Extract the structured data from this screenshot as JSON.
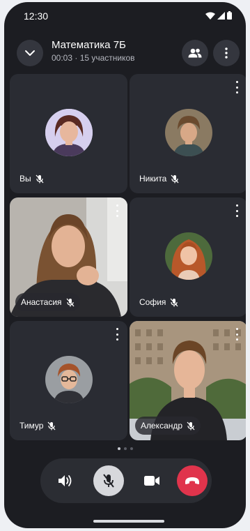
{
  "status_bar": {
    "time": "12:30"
  },
  "header": {
    "title": "Математика 7Б",
    "subtitle": "00:03 · 15 участников"
  },
  "participants": [
    {
      "name": "Вы",
      "mic_muted": true,
      "video": false
    },
    {
      "name": "Никита",
      "mic_muted": true,
      "video": false
    },
    {
      "name": "Анастасия",
      "mic_muted": true,
      "video": true
    },
    {
      "name": "София",
      "mic_muted": true,
      "video": false
    },
    {
      "name": "Тимур",
      "mic_muted": true,
      "video": false
    },
    {
      "name": "Александр",
      "mic_muted": true,
      "video": true
    }
  ],
  "pagination": {
    "pages": 3,
    "current": 1
  },
  "controls": [
    "speaker",
    "microphone-off",
    "camera",
    "end-call"
  ],
  "colors": {
    "background": "#1c1d22",
    "tile": "#2a2c33",
    "end_call": "#e0344c",
    "mic_button_active": "#d7d8dc"
  }
}
